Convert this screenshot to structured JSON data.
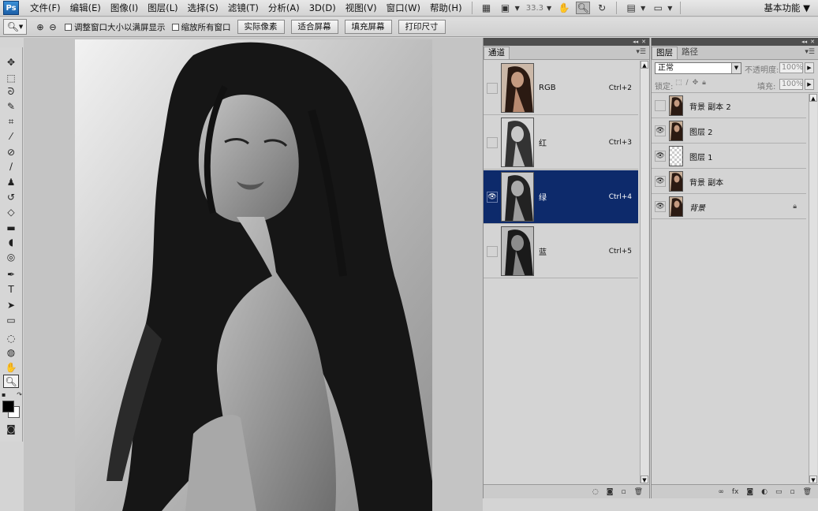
{
  "app": {
    "logo": "Ps",
    "menu": [
      "文件(F)",
      "编辑(E)",
      "图像(I)",
      "图层(L)",
      "选择(S)",
      "滤镜(T)",
      "分析(A)",
      "3D(D)",
      "视图(V)",
      "窗口(W)",
      "帮助(H)"
    ],
    "zoom_level": "33.3",
    "workspace": "基本功能"
  },
  "options": {
    "resize_windows_label": "调整窗口大小以满屏显示",
    "zoom_all_label": "缩放所有窗口",
    "buttons": [
      "实际像素",
      "适合屏幕",
      "填充屏幕",
      "打印尺寸"
    ]
  },
  "channels_panel": {
    "tab": "通道",
    "rows": [
      {
        "name": "RGB",
        "shortcut": "Ctrl+2",
        "visible": false,
        "selected": false
      },
      {
        "name": "红",
        "shortcut": "Ctrl+3",
        "visible": false,
        "selected": false
      },
      {
        "name": "绿",
        "shortcut": "Ctrl+4",
        "visible": true,
        "selected": true
      },
      {
        "name": "蓝",
        "shortcut": "Ctrl+5",
        "visible": false,
        "selected": false
      }
    ]
  },
  "layers_panel": {
    "tabs": [
      "图层",
      "路径"
    ],
    "blend_mode": "正常",
    "opacity_label": "不透明度:",
    "opacity_value": "100%",
    "lock_label": "锁定:",
    "fill_label": "填充:",
    "fill_value": "100%",
    "rows": [
      {
        "name": "背景 副本 2",
        "visible": false,
        "thumb": "photo",
        "locked": false,
        "italic": false
      },
      {
        "name": "图层 2",
        "visible": true,
        "thumb": "photo",
        "locked": false,
        "italic": false
      },
      {
        "name": "图层 1",
        "visible": true,
        "thumb": "transparent",
        "locked": false,
        "italic": false
      },
      {
        "name": "背景 副本",
        "visible": true,
        "thumb": "photo",
        "locked": false,
        "italic": false
      },
      {
        "name": "背景",
        "visible": true,
        "thumb": "photo",
        "locked": true,
        "italic": true
      }
    ]
  },
  "colors": {
    "selection": "#0d2a6b",
    "panel_bg": "#d4d4d4",
    "foreground": "#000000",
    "background": "#ffffff"
  }
}
